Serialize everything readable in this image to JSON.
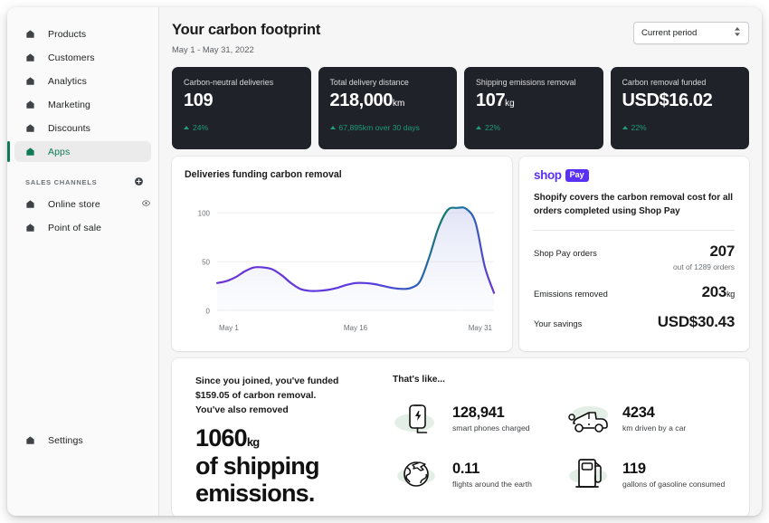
{
  "sidebar": {
    "items": [
      {
        "label": "Products",
        "icon": "home-icon",
        "active": false
      },
      {
        "label": "Customers",
        "icon": "home-icon",
        "active": false
      },
      {
        "label": "Analytics",
        "icon": "home-icon",
        "active": false
      },
      {
        "label": "Marketing",
        "icon": "home-icon",
        "active": false
      },
      {
        "label": "Discounts",
        "icon": "home-icon",
        "active": false
      },
      {
        "label": "Apps",
        "icon": "home-icon",
        "active": true
      }
    ],
    "section_title": "SALES CHANNELS",
    "add_icon": "plus-circle-icon",
    "channels": [
      {
        "label": "Online store",
        "icon": "home-icon",
        "trailing_icon": "eye-icon"
      },
      {
        "label": "Point of sale",
        "icon": "home-icon",
        "trailing_icon": ""
      }
    ],
    "settings": {
      "label": "Settings",
      "icon": "home-icon"
    },
    "active_color": "#0e7a56"
  },
  "header": {
    "title": "Your carbon footprint",
    "date_range": "May 1 - May 31, 2022",
    "period_select": "Current period"
  },
  "stats": [
    {
      "label": "Carbon-neutral deliveries",
      "value": "109",
      "unit": "",
      "delta": "24%"
    },
    {
      "label": "Total delivery distance",
      "value": "218,000",
      "unit": "km",
      "delta": "67,895km over 30 days"
    },
    {
      "label": "Shipping emissions removal",
      "value": "107",
      "unit": "kg",
      "delta": "22%"
    },
    {
      "label": "Carbon removal funded",
      "value": "USD$16.02",
      "unit": "",
      "delta": "22%"
    }
  ],
  "chart_data": {
    "type": "line",
    "title": "Deliveries funding carbon removal",
    "xlabel": "",
    "ylabel": "",
    "ylim": [
      0,
      115
    ],
    "yticks": [
      0,
      50,
      100
    ],
    "ytick_labels": [
      "0",
      "50",
      "100"
    ],
    "xtick_labels": [
      "May 1",
      "May 16",
      "May 31"
    ],
    "grid": true,
    "legend": "none",
    "line_color_start": "#6b33d6",
    "line_color_end": "#117b63",
    "x": [
      1,
      2,
      3,
      4,
      5,
      6,
      7,
      8,
      9,
      10,
      11,
      12,
      13,
      14,
      15,
      16,
      17,
      18,
      19,
      20,
      21,
      22,
      23,
      24,
      25,
      26,
      27,
      28,
      29,
      30,
      31
    ],
    "values": [
      28,
      30,
      34,
      40,
      44,
      44,
      42,
      36,
      28,
      22,
      20,
      20,
      21,
      23,
      26,
      28,
      28,
      27,
      25,
      23,
      22,
      23,
      30,
      55,
      85,
      103,
      105,
      104,
      90,
      45,
      18
    ]
  },
  "shop_pay": {
    "brand_word": "shop",
    "brand_badge": "Pay",
    "brand_color": "#5a31f4",
    "description": "Shopify covers the carbon removal cost for all orders completed using Shop Pay",
    "rows": [
      {
        "label": "Shop Pay orders",
        "value": "207",
        "unit": "",
        "sub": "out of 1289 orders"
      },
      {
        "label": "Emissions removed",
        "value": "203",
        "unit": "kg",
        "sub": ""
      },
      {
        "label": "Your savings",
        "value": "USD$30.43",
        "unit": "",
        "sub": ""
      }
    ]
  },
  "impact": {
    "lead_line1": "Since you joined, you've funded",
    "lead_line2": "$159.05 of carbon removal.",
    "lead_line3": "You've also removed",
    "big_value": "1060",
    "big_unit": "kg",
    "big_line2": "of shipping",
    "big_line3": "emissions.",
    "likes_title": "That's like...",
    "equivalents": [
      {
        "value": "128,941",
        "caption": "smart phones charged",
        "icon": "phone-charging-icon"
      },
      {
        "value": "4234",
        "caption": "km driven by a car",
        "icon": "car-icon"
      },
      {
        "value": "0.11",
        "caption": "flights around the earth",
        "icon": "globe-plane-icon"
      },
      {
        "value": "119",
        "caption": "gallons of gasoline consumed",
        "icon": "gas-pump-icon"
      }
    ]
  }
}
